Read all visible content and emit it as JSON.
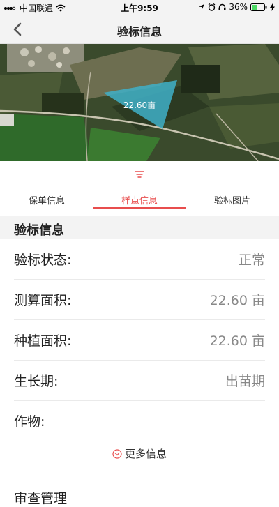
{
  "status_bar": {
    "carrier": "中国联通",
    "time": "上午9:59",
    "battery": "36%"
  },
  "nav": {
    "title": "验标信息"
  },
  "map": {
    "area_label": "22.60亩"
  },
  "tabs": [
    {
      "label": "保单信息",
      "active": false
    },
    {
      "label": "样点信息",
      "active": true
    },
    {
      "label": "验标图片",
      "active": false
    }
  ],
  "section": {
    "title": "验标信息"
  },
  "rows": [
    {
      "label": "验标状态:",
      "value": "正常"
    },
    {
      "label": "测算面积:",
      "value": "22.60 亩"
    },
    {
      "label": "种植面积:",
      "value": "22.60 亩"
    },
    {
      "label": "生长期:",
      "value": "出苗期"
    },
    {
      "label": "作物:",
      "value": ""
    }
  ],
  "more_label": "更多信息",
  "next_section_title": "审查管理",
  "colors": {
    "accent": "#e84d4d",
    "area_fill": "#3fb0c8"
  },
  "icons": [
    "signal-icon",
    "wifi-icon",
    "location-arrow-icon",
    "alarm-icon",
    "headphones-icon",
    "battery-icon",
    "charging-icon",
    "back-chevron-icon",
    "sort-handle-icon",
    "chevron-down-circle-icon"
  ]
}
